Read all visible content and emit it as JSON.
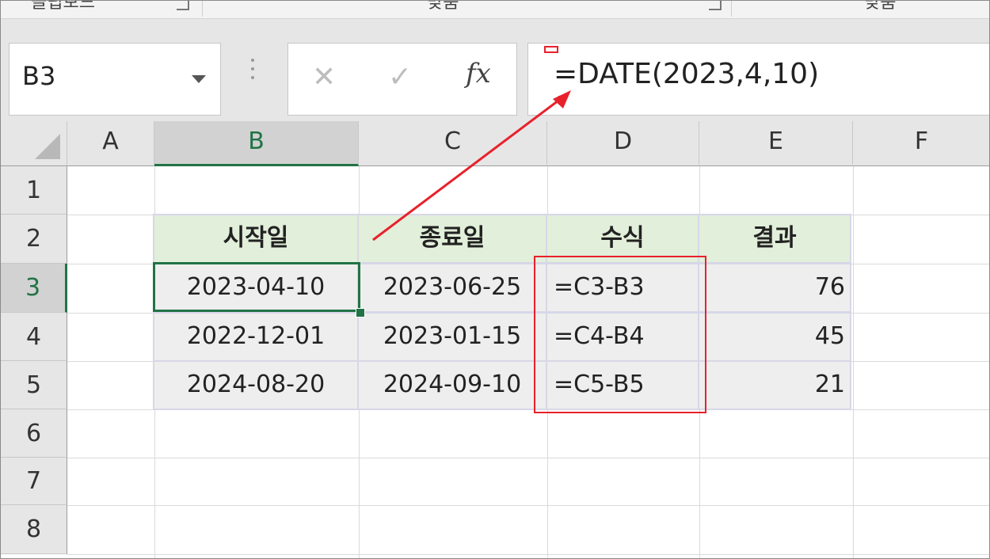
{
  "ribbon": {
    "groups": [
      "클립보드",
      "맞춤",
      "맞춤"
    ]
  },
  "formula_bar": {
    "name_box": "B3",
    "cancel_icon": "✕",
    "enter_icon": "✓",
    "fx_label": "fx",
    "formula": "=DATE(2023,4,10)"
  },
  "sheet": {
    "columns": [
      "A",
      "B",
      "C",
      "D",
      "E",
      "F"
    ],
    "rows": [
      "1",
      "2",
      "3",
      "4",
      "5",
      "6",
      "7",
      "8"
    ],
    "header_row": [
      "시작일",
      "종료일",
      "수식",
      "결과"
    ],
    "data": [
      {
        "start": "2023-04-10",
        "end": "2023-06-25",
        "formula": "=C3-B3",
        "result": "76"
      },
      {
        "start": "2022-12-01",
        "end": "2023-01-15",
        "formula": "=C4-B4",
        "result": "45"
      },
      {
        "start": "2024-08-20",
        "end": "2024-09-10",
        "formula": "=C5-B5",
        "result": "21"
      }
    ],
    "selected_cell": "B3"
  },
  "colors": {
    "excel_green": "#217346",
    "header_fill": "#e2efda",
    "annotation_red": "#e8212b"
  }
}
